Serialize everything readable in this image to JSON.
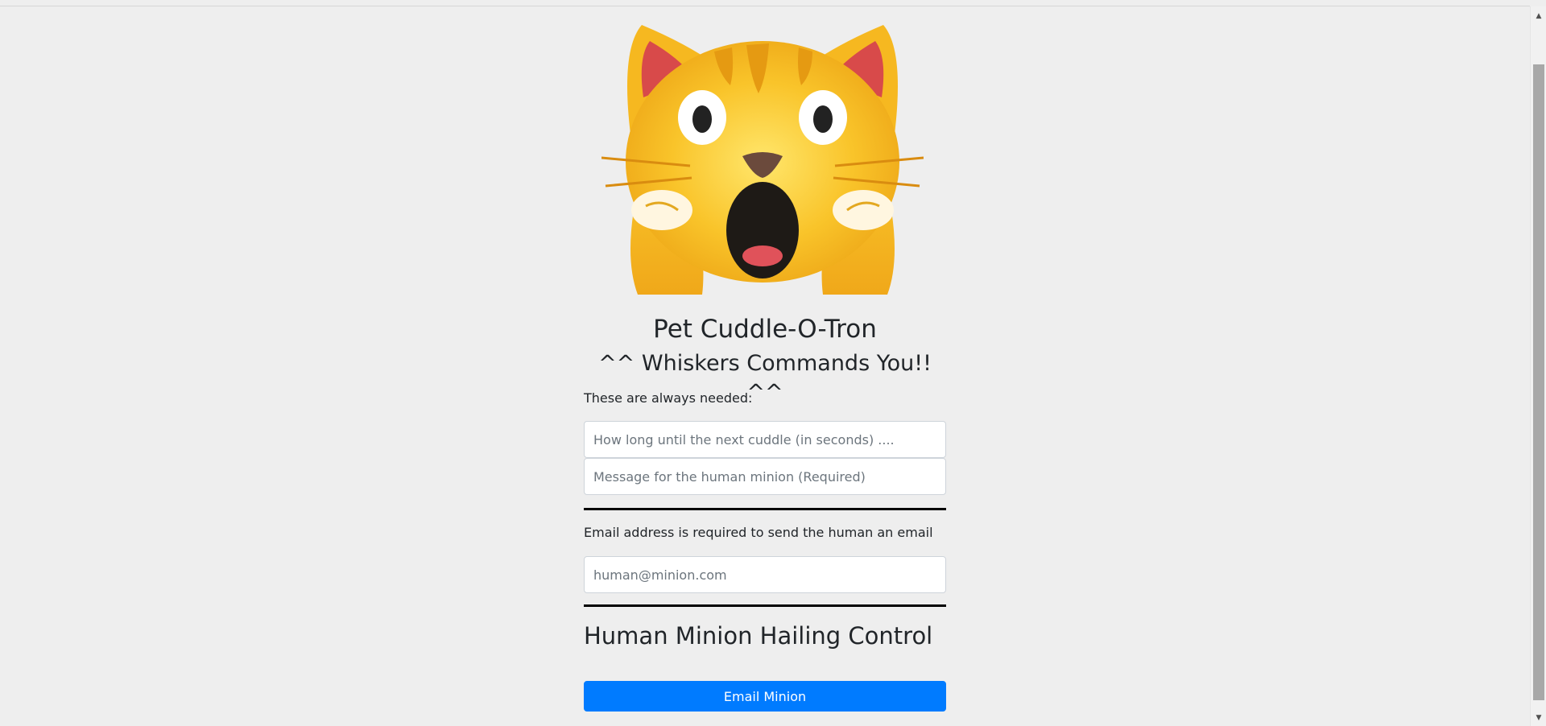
{
  "header": {
    "title": "Pet Cuddle-O-Tron",
    "subtitle": "^^ Whiskers Commands You!! ^^"
  },
  "image": {
    "icon": "shocked-cat-icon"
  },
  "form": {
    "needed_label": "These are always needed:",
    "seconds_placeholder": "How long until the next cuddle (in seconds) ....",
    "message_placeholder": "Message for the human minion (Required)",
    "email_label": "Email address is required to send the human an email",
    "email_placeholder": "human@minion.com"
  },
  "controls": {
    "section_title": "Human Minion Hailing Control",
    "email_button_label": "Email Minion"
  },
  "colors": {
    "background": "#eeeeee",
    "primary_button": "#007bff",
    "text": "#212529"
  }
}
